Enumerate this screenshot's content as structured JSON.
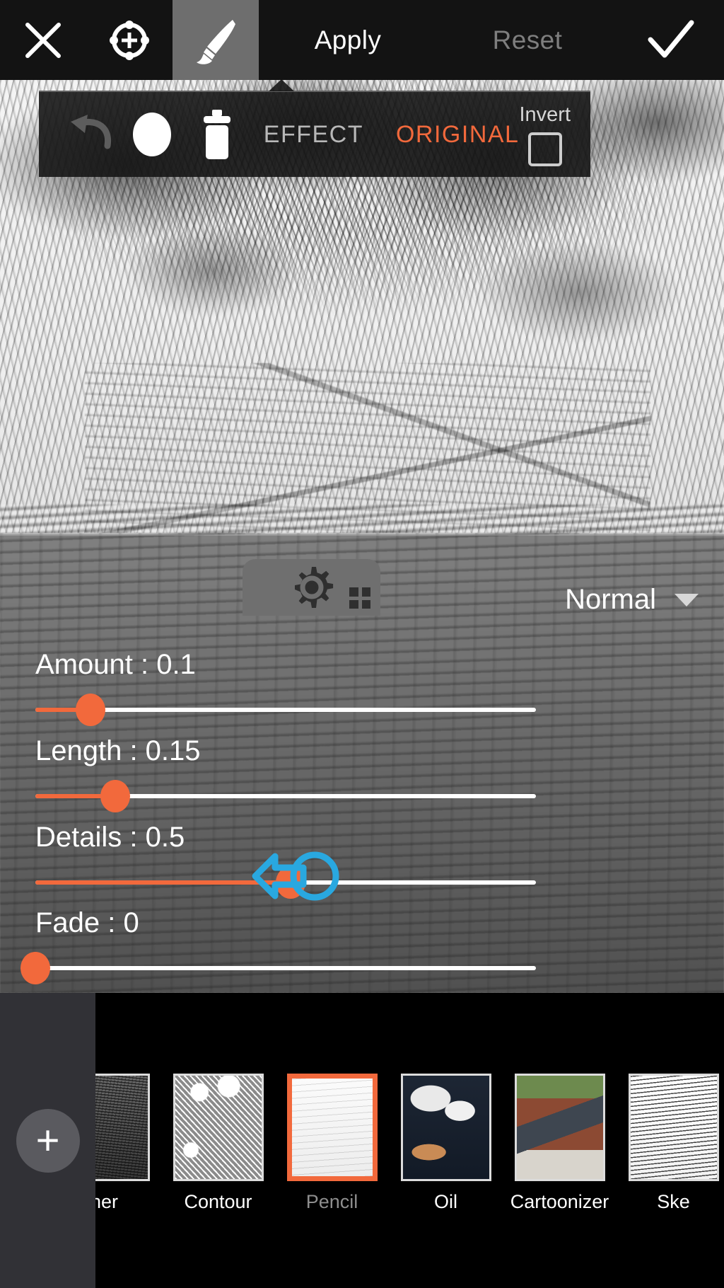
{
  "app": {
    "accent": "#f2693c",
    "panel_bg": "#484848",
    "toolbar_bg": "#131313"
  },
  "toolbar": {
    "close_icon": "close-x-icon",
    "target_icon": "target-crosshair-icon",
    "brush_icon": "paintbrush-icon",
    "apply_label": "Apply",
    "reset_label": "Reset",
    "confirm_icon": "checkmark-icon"
  },
  "effect_bar": {
    "undo_icon": "undo-arrow-icon",
    "brush_shape_icon": "filled-circle-icon",
    "trash_icon": "trash-can-icon",
    "effect_label": "EFFECT",
    "original_label": "ORIGINAL",
    "invert_label": "Invert",
    "invert_checked": false,
    "active_mode": "ORIGINAL"
  },
  "canvas": {
    "settings_icon": "gear-settings-icon",
    "grid_icon": "grid-dots-icon"
  },
  "panel": {
    "blend_mode": "Normal",
    "blend_caret_icon": "chevron-down-icon",
    "sliders": [
      {
        "name": "amount",
        "label": "Amount : 0.1",
        "value": 0.1,
        "fill_pct": 11
      },
      {
        "name": "length",
        "label": "Length : 0.15",
        "value": 0.15,
        "fill_pct": 16
      },
      {
        "name": "details",
        "label": "Details : 0.5",
        "value": 0.5,
        "fill_pct": 51
      },
      {
        "name": "fade",
        "label": "Fade : 0",
        "value": 0,
        "fill_pct": 0
      }
    ],
    "annotation": {
      "icon": "left-arrow-annotation",
      "color": "#29a8e0",
      "target": "details"
    }
  },
  "filter_strip": {
    "add_label": "+",
    "items": [
      {
        "label": "her",
        "art": "art-feather",
        "selected": false,
        "partial": true
      },
      {
        "label": "Contour",
        "art": "art-contour",
        "selected": false,
        "partial": false
      },
      {
        "label": "Pencil",
        "art": "art-pencil",
        "selected": true,
        "partial": false
      },
      {
        "label": "Oil",
        "art": "art-oil",
        "selected": false,
        "partial": false
      },
      {
        "label": "Cartoonizer",
        "art": "art-cartoon",
        "selected": false,
        "partial": false
      },
      {
        "label": "Ske",
        "art": "art-sketcher",
        "selected": false,
        "partial": true
      }
    ]
  }
}
